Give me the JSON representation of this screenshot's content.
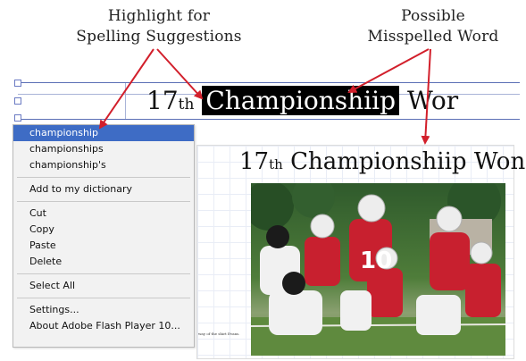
{
  "callouts": {
    "left": {
      "line1": "Highlight for",
      "line2": "Spelling Suggestions"
    },
    "right": {
      "line1": "Possible",
      "line2": "Misspelled Word"
    }
  },
  "headline": {
    "prefix": "17",
    "superscript": "th",
    "misspelled_word": "Championshiip",
    "suffix": "Wor"
  },
  "context_menu": {
    "suggestions": [
      "championship",
      "championships",
      "championship's"
    ],
    "add_to_dictionary": "Add to my dictionary",
    "cut": "Cut",
    "copy": "Copy",
    "paste": "Paste",
    "delete": "Delete",
    "select_all": "Select All",
    "settings": "Settings...",
    "about": "About Adobe Flash Player 10..."
  },
  "preview": {
    "title_prefix": "17",
    "title_superscript": "th",
    "title_text": "Championshiip Won",
    "caption": "way of the shirt Evans."
  },
  "colors": {
    "menu_highlight": "#3e6cc5",
    "arrow": "#d21f2b",
    "guide": "#5b6fb5",
    "jersey_red": "#c8202f"
  }
}
